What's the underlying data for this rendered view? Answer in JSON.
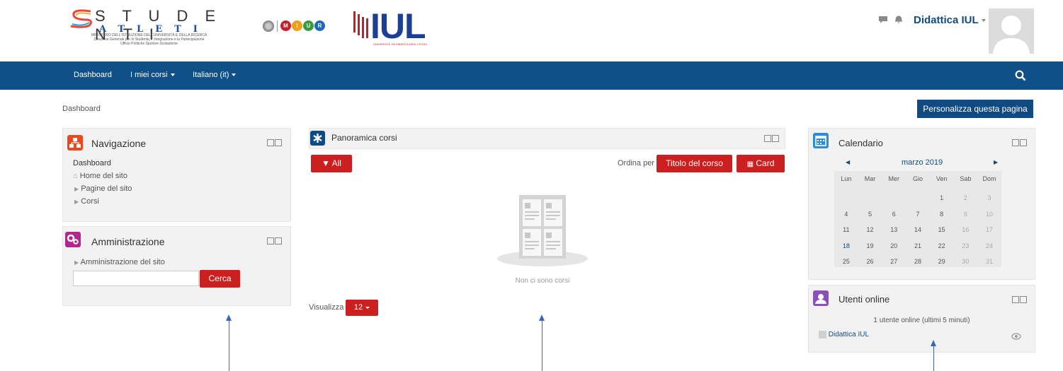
{
  "header": {
    "studenti_row1": "S T U D E N T I",
    "studenti_row2": "ATLETI",
    "ministry_line1": "MINISTERO DELL'ISTRUZIONE DELL'UNIVERSITÀ E DELLA RICERCA",
    "ministry_line2": "Direzione Generale per lo Studente, l' Integrazione e la Partecipazione",
    "ministry_line3": "Ufficio Politiche Sportive Scolastiche",
    "miur_letters": [
      "M",
      "I",
      "U",
      "R"
    ],
    "iul_logo": "IUL",
    "iul_subtitle": "UNIVERSITÀ TELEMATICA DEGLI STUDI",
    "user_name": "Didattica IUL"
  },
  "navbar": {
    "items": [
      "Dashboard",
      "I miei corsi",
      "Italiano (it)"
    ]
  },
  "breadcrumb": "Dashboard",
  "customize_button": "Personalizza questa pagina",
  "navigation_block": {
    "title": "Navigazione",
    "items": [
      "Dashboard",
      "Home del sito",
      "Pagine del sito",
      "Corsi"
    ]
  },
  "admin_block": {
    "title": "Amministrazione",
    "item": "Amministrazione del sito",
    "search_value": "",
    "search_button": "Cerca"
  },
  "courses_block": {
    "title": "Panoramica corsi",
    "filter_button": "All",
    "sort_label": "Ordina per",
    "sort_button": "Titolo del corso",
    "view_button": "Card",
    "empty_text": "Non ci sono corsi",
    "show_label": "Visualizza",
    "show_value": "12"
  },
  "calendar_block": {
    "title": "Calendario",
    "month": "marzo 2019",
    "weekdays": [
      "Lun",
      "Mar",
      "Mer",
      "Gio",
      "Ven",
      "Sab",
      "Dom"
    ],
    "weeks": [
      [
        "",
        "",
        "",
        "",
        "1",
        "2",
        "3"
      ],
      [
        "4",
        "5",
        "6",
        "7",
        "8",
        "9",
        "10"
      ],
      [
        "11",
        "12",
        "13",
        "14",
        "15",
        "16",
        "17"
      ],
      [
        "18",
        "19",
        "20",
        "21",
        "22",
        "23",
        "24"
      ],
      [
        "25",
        "26",
        "27",
        "28",
        "29",
        "30",
        "31"
      ]
    ]
  },
  "online_block": {
    "title": "Utenti online",
    "summary": "1 utente online (ultimi 5 minuti)",
    "user": "Didattica IUL"
  },
  "colors": {
    "navbar": "#0f5088",
    "accent_red": "#cc1f1f",
    "nav_icon": "#e8491d",
    "admin_icon": "#b0278f",
    "courses_icon": "#0f4a82",
    "calendar_icon": "#2b8dd6",
    "online_icon": "#8a4fb8"
  }
}
